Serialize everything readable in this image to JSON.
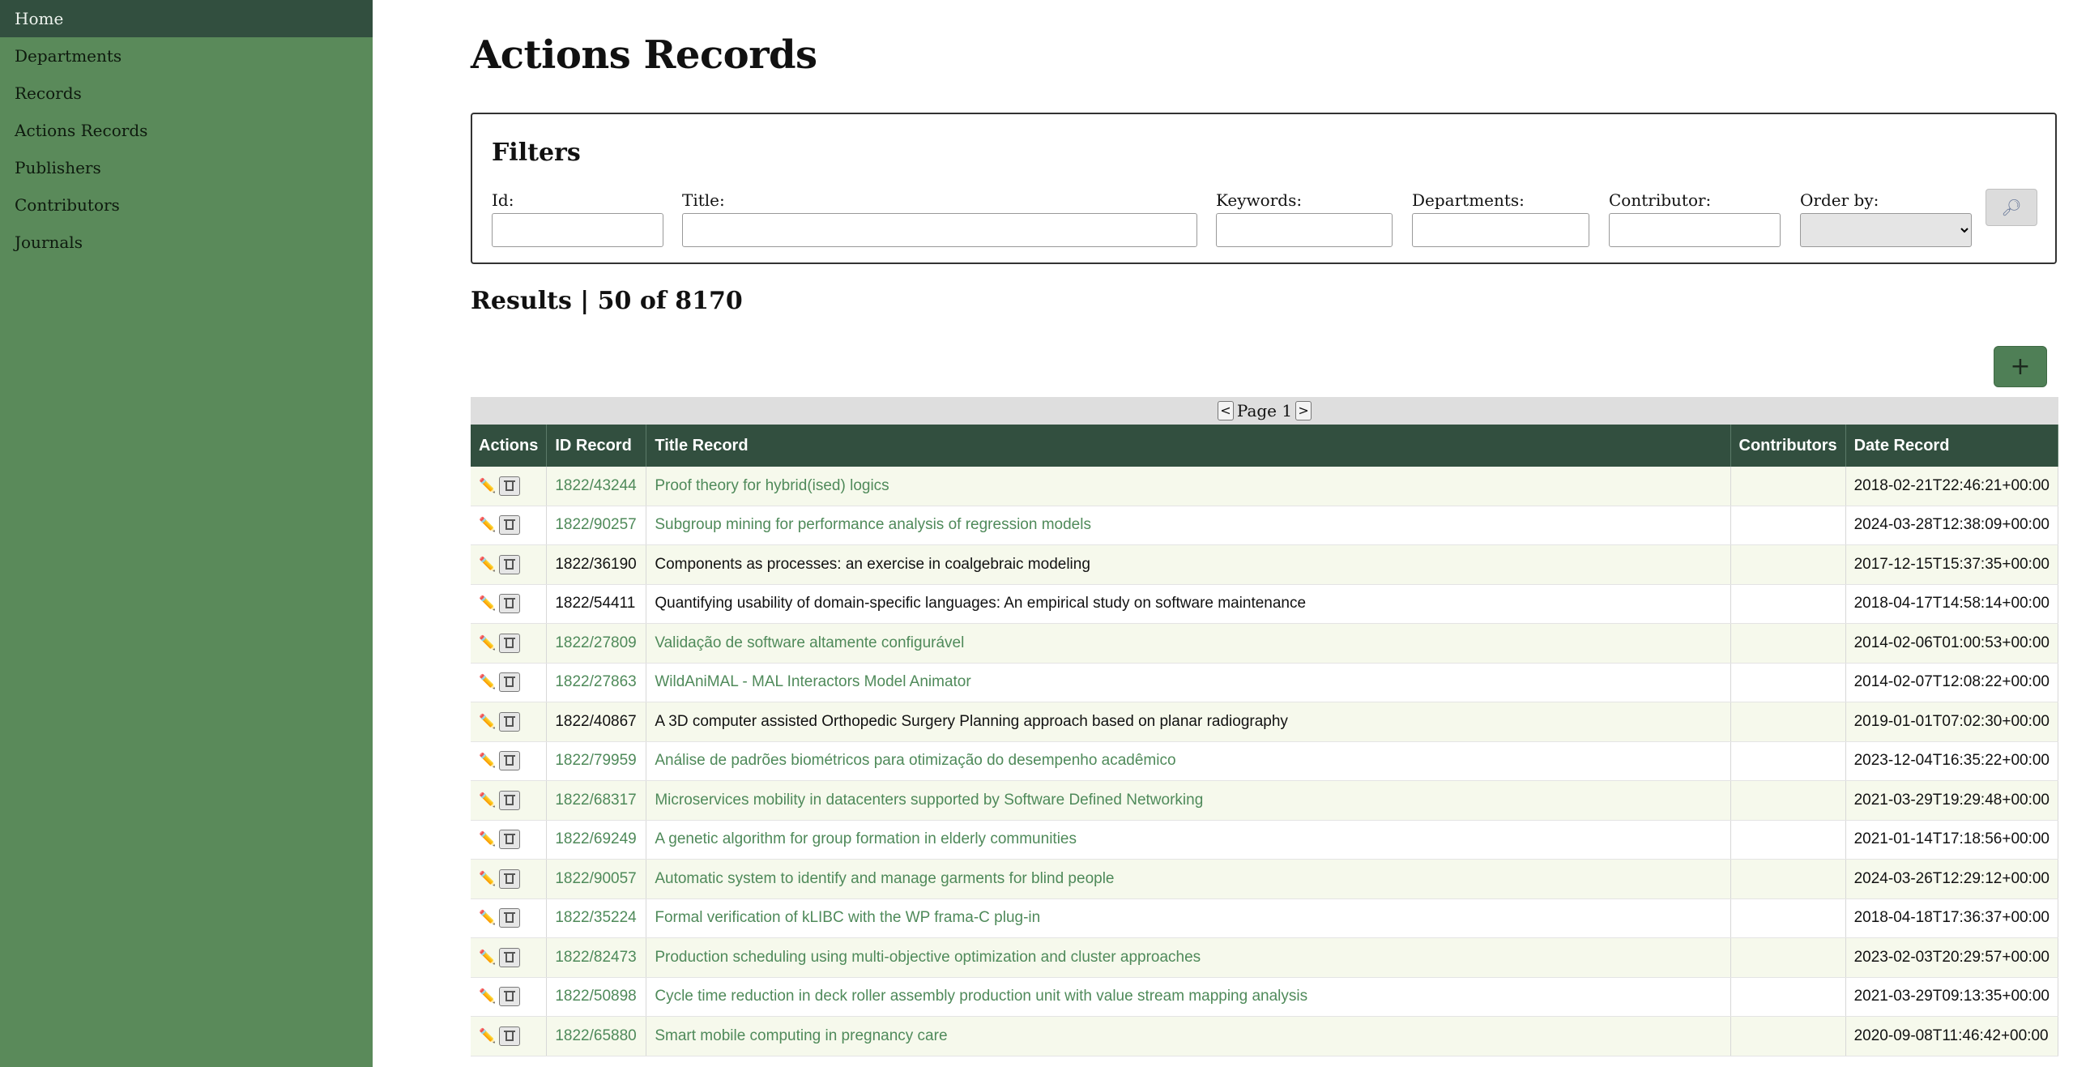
{
  "sidebar": {
    "items": [
      {
        "label": "Home",
        "active": true
      },
      {
        "label": "Departments"
      },
      {
        "label": "Records"
      },
      {
        "label": "Actions Records"
      },
      {
        "label": "Publishers"
      },
      {
        "label": "Contributors"
      },
      {
        "label": "Journals"
      }
    ]
  },
  "page_title": "Actions Records",
  "filters": {
    "title": "Filters",
    "fields": {
      "id": {
        "label": "Id:",
        "value": ""
      },
      "title": {
        "label": "Title:",
        "value": ""
      },
      "keywords": {
        "label": "Keywords:",
        "value": ""
      },
      "departments": {
        "label": "Departments:",
        "value": ""
      },
      "contributor": {
        "label": "Contributor:",
        "value": ""
      },
      "order_by": {
        "label": "Order by:",
        "value": ""
      }
    },
    "search_icon": "search-icon"
  },
  "results": {
    "heading": "Results  |  50 of 8170"
  },
  "add_button_label": "+",
  "pager": {
    "prev": "<",
    "label": "Page 1",
    "next": ">"
  },
  "table": {
    "columns": [
      "Actions",
      "ID Record",
      "Title Record",
      "Contributors",
      "Date Record"
    ],
    "rows": [
      {
        "id": "1822/43244",
        "title": "Proof theory for hybrid(ised) logics",
        "contributors": "",
        "date": "2018-02-21T22:46:21+00:00",
        "link": true
      },
      {
        "id": "1822/90257",
        "title": "Subgroup mining for performance analysis of regression models",
        "contributors": "",
        "date": "2024-03-28T12:38:09+00:00",
        "link": true
      },
      {
        "id": "1822/36190",
        "title": "Components as processes: an exercise in coalgebraic modeling",
        "contributors": "",
        "date": "2017-12-15T15:37:35+00:00",
        "link": false
      },
      {
        "id": "1822/54411",
        "title": "Quantifying usability of domain-specific languages: An empirical study on software maintenance",
        "contributors": "",
        "date": "2018-04-17T14:58:14+00:00",
        "link": false
      },
      {
        "id": "1822/27809",
        "title": "Validação de software altamente configurável",
        "contributors": "",
        "date": "2014-02-06T01:00:53+00:00",
        "link": true
      },
      {
        "id": "1822/27863",
        "title": "WildAniMAL - MAL Interactors Model Animator",
        "contributors": "",
        "date": "2014-02-07T12:08:22+00:00",
        "link": true
      },
      {
        "id": "1822/40867",
        "title": "A 3D computer assisted Orthopedic Surgery Planning approach based on planar radiography",
        "contributors": "",
        "date": "2019-01-01T07:02:30+00:00",
        "link": false
      },
      {
        "id": "1822/79959",
        "title": "Análise de padrões biométricos para otimização do desempenho acadêmico",
        "contributors": "",
        "date": "2023-12-04T16:35:22+00:00",
        "link": true
      },
      {
        "id": "1822/68317",
        "title": "Microservices mobility in datacenters supported by Software Defined Networking",
        "contributors": "",
        "date": "2021-03-29T19:29:48+00:00",
        "link": true
      },
      {
        "id": "1822/69249",
        "title": "A genetic algorithm for group formation in elderly communities",
        "contributors": "",
        "date": "2021-01-14T17:18:56+00:00",
        "link": true
      },
      {
        "id": "1822/90057",
        "title": "Automatic system to identify and manage garments for blind people",
        "contributors": "",
        "date": "2024-03-26T12:29:12+00:00",
        "link": true
      },
      {
        "id": "1822/35224",
        "title": "Formal verification of kLIBC with the WP frama-C plug-in",
        "contributors": "",
        "date": "2018-04-18T17:36:37+00:00",
        "link": true
      },
      {
        "id": "1822/82473",
        "title": "Production scheduling using multi-objective optimization and cluster approaches",
        "contributors": "",
        "date": "2023-02-03T20:29:57+00:00",
        "link": true
      },
      {
        "id": "1822/50898",
        "title": "Cycle time reduction in deck roller assembly production unit with value stream mapping analysis",
        "contributors": "",
        "date": "2021-03-29T09:13:35+00:00",
        "link": true
      },
      {
        "id": "1822/65880",
        "title": "Smart mobile computing in pregnancy care",
        "contributors": "",
        "date": "2020-09-08T11:46:42+00:00",
        "link": true
      }
    ]
  },
  "colors": {
    "sidebar_bg": "#5a8a5a",
    "header_bg": "#324f3f",
    "link": "#4f8a5a",
    "add_button": "#4f7f56"
  }
}
